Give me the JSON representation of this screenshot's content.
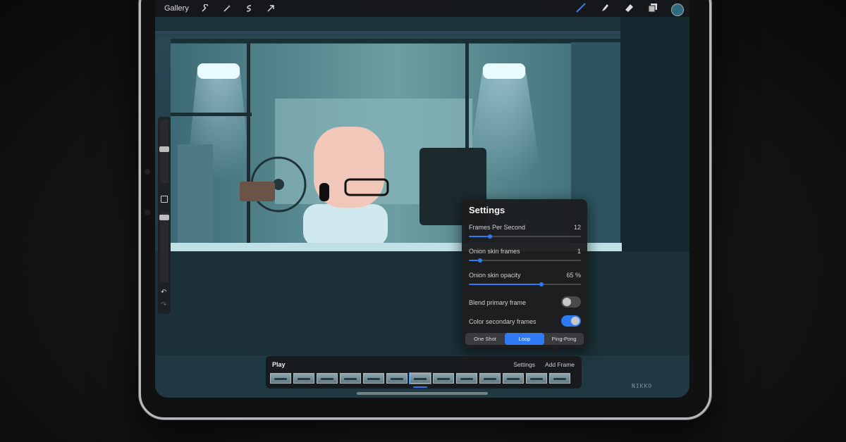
{
  "toolbar": {
    "gallery_label": "Gallery",
    "left_icons": [
      "wrench-icon",
      "magic-wand-icon",
      "selection-icon",
      "transform-arrow-icon"
    ],
    "right_icons": [
      "brush-icon",
      "smudge-icon",
      "eraser-icon",
      "layers-icon"
    ],
    "active_color": "#2d6b80",
    "accent_color": "#2f7bf6"
  },
  "settings": {
    "title": "Settings",
    "fps": {
      "label": "Frames Per Second",
      "value": "12",
      "level": 0.19
    },
    "onion_frames": {
      "label": "Onion skin frames",
      "value": "1",
      "level": 0.1
    },
    "onion_opacity": {
      "label": "Onion skin opacity",
      "value": "65 %",
      "level": 0.65
    },
    "blend_primary": {
      "label": "Blend primary frame",
      "on": false
    },
    "color_secondary": {
      "label": "Color secondary frames",
      "on": true
    },
    "modes": [
      "One Shot",
      "Loop",
      "Ping-Pong"
    ],
    "active_mode": "Loop"
  },
  "timeline": {
    "play_label": "Play",
    "settings_label": "Settings",
    "add_frame_label": "Add Frame",
    "frame_count": 13,
    "current_frame": 7
  },
  "artwork": {
    "signature": "NIKKO"
  }
}
